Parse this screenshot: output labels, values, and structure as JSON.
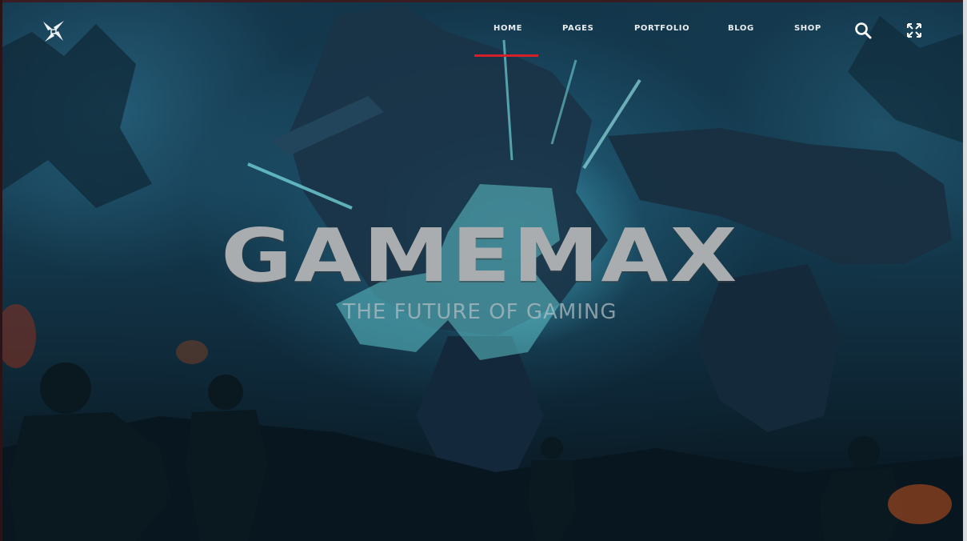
{
  "brand": {
    "title": "GAMEMAX",
    "tagline": "THE FUTURE OF GAMING"
  },
  "nav": {
    "items": [
      {
        "label": "HOME",
        "active": true
      },
      {
        "label": "PAGES",
        "active": false
      },
      {
        "label": "PORTFOLIO",
        "active": false
      },
      {
        "label": "BLOG",
        "active": false
      },
      {
        "label": "SHOP",
        "active": false
      }
    ]
  },
  "icons": {
    "logo": "x-star-logo-icon",
    "search": "search-icon",
    "fullscreen": "expand-icon"
  },
  "colors": {
    "accent": "#d3202a",
    "nav_text": "#e9eef1",
    "title_text": "#a9adb0",
    "background": "#14384d"
  }
}
